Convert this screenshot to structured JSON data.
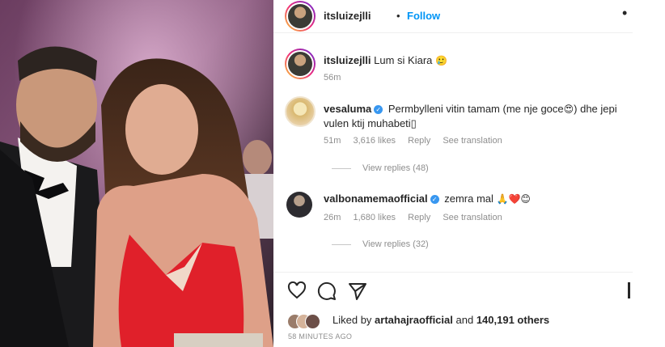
{
  "post": {
    "author": "itsluizejlli",
    "separator": "•",
    "follow_label": "Follow",
    "more_icon": "more-dots-icon"
  },
  "caption": {
    "username": "itsluizejlli",
    "text": "Lum si Kiara",
    "emoji": "🥲",
    "age": "56m"
  },
  "comments": [
    {
      "username": "vesaluma",
      "verified": true,
      "text": "Permbylleni vitin tamam (me nje goce",
      "emoji": "😍",
      "text2": ") dhe jepi",
      "text_line2": "vulen ktij muhabeti",
      "text_line2_suffix": "▯",
      "age": "51m",
      "likes": "3,616 likes",
      "reply": "Reply",
      "translate": "See translation",
      "view_replies": "View replies (48)"
    },
    {
      "username": "valbonamemaofficial",
      "verified": true,
      "text": "zemra mal",
      "emoji": "🙏❤️😊",
      "age": "26m",
      "likes": "1,680 likes",
      "reply": "Reply",
      "translate": "See translation",
      "view_replies": "View replies (32)"
    }
  ],
  "actions": {
    "icons": [
      "heart-icon",
      "comment-icon",
      "share-icon",
      "save-icon"
    ]
  },
  "likes": {
    "prefix": "Liked by",
    "user": "artahajraofficial",
    "and": "and",
    "others": "140,191 others"
  },
  "timestamp": "58 MINUTES AGO",
  "colors": {
    "accent": "#0095f6",
    "verified": "#3897f0",
    "dress": "#e0202a",
    "background_photo": "#4a2f3f"
  }
}
